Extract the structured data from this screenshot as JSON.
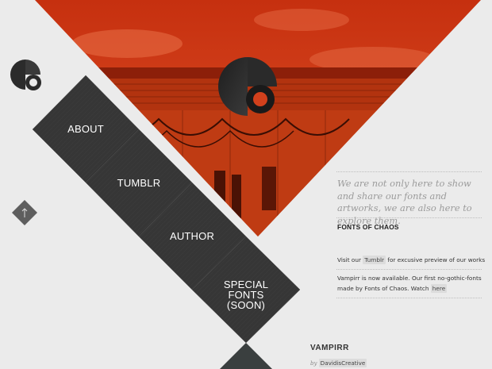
{
  "brand": {
    "logo_icon": "fonts-of-chaos-logo-icon",
    "accent": "#d1401c",
    "diamond_color": "#363636"
  },
  "nav": {
    "items": [
      {
        "label": "ABOUT"
      },
      {
        "label": "TUMBLR"
      },
      {
        "label": "AUTHOR"
      },
      {
        "label": "SPECIAL FONTS",
        "label2": "(SOON)"
      }
    ]
  },
  "scroll_up": {
    "icon": "arrow-up-icon"
  },
  "intro": {
    "text": "We are not only here to show and share our fonts and artworks, we are also here to explore them."
  },
  "section": {
    "title": "FONTS OF CHAOS",
    "line1_pre": "Visit our",
    "line1_link": "Tumblr",
    "line1_post": "for excusive preview of our works",
    "line2_pre": "Vampirr is now available. Our first no-gothic-fonts made by Fonts of Chaos. Watch",
    "line2_link": "here"
  },
  "post": {
    "title": "VAMPIRR",
    "by": "by",
    "author": "DavidisCreative"
  }
}
